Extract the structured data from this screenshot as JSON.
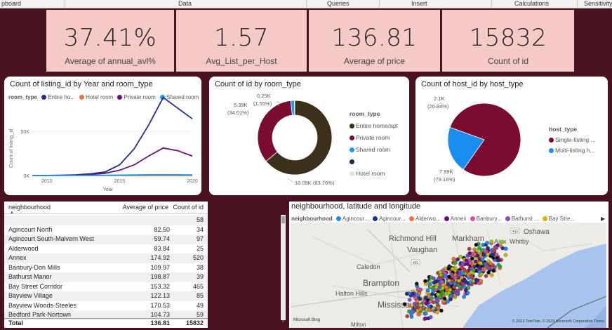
{
  "ribbon": {
    "tabs": [
      "pboard",
      "Data",
      "Queries",
      "Insert",
      "Calculations",
      "Sensitivity"
    ]
  },
  "kpis": [
    {
      "value": "37.41%",
      "label": "Average of annual_avl%"
    },
    {
      "value": "1.57",
      "label": "Avg_List_per_Host"
    },
    {
      "value": "136.81",
      "label": "Average of price"
    },
    {
      "value": "15832",
      "label": "Count of id"
    }
  ],
  "line_card": {
    "title": "Count of listing_id by Year and room_type",
    "legend_title": "room_type",
    "legend": [
      "Entire ho...",
      "Hotel room",
      "Private room",
      "Shared room"
    ]
  },
  "donut_card": {
    "title": "Count of id by room_type",
    "legend_title": "room_type",
    "legend": [
      "Entire home/apt",
      "Private room",
      "Shared room",
      "",
      "Hotel room"
    ],
    "labels": {
      "shared": "0.25K",
      "shared_pct": "(1.55%)",
      "private": "5.39K",
      "private_pct": "(34.01%)",
      "entire": "10.09K (63.76%)"
    }
  },
  "pie_card": {
    "title": "Count of host_id by host_type",
    "legend_title": "host_type",
    "legend": [
      "Single-listing ...",
      "Multi-listing h..."
    ],
    "labels": {
      "multi": "2.1K",
      "multi_pct": "(20.84%)",
      "single": "7.99K",
      "single_pct": "(79.16%)"
    }
  },
  "table": {
    "headers": [
      "neighbourhood",
      "Average of price",
      "Count of id"
    ],
    "rows": [
      [
        "",
        "",
        "58"
      ],
      [
        "Agincourt North",
        "82.50",
        "34"
      ],
      [
        "Agincourt South-Malvern West",
        "59.74",
        "97"
      ],
      [
        "Alderwood",
        "83.84",
        "25"
      ],
      [
        "Annex",
        "174.92",
        "520"
      ],
      [
        "Banbury-Don Mills",
        "109.97",
        "38"
      ],
      [
        "Bathurst Manor",
        "198.87",
        "39"
      ],
      [
        "Bay Street Corridor",
        "153.32",
        "465"
      ],
      [
        "Bayview Village",
        "122.13",
        "85"
      ],
      [
        "Bayview Woods-Steeles",
        "170.53",
        "49"
      ],
      [
        "Bedford Park-Nortown",
        "104.73",
        "59"
      ]
    ],
    "total": [
      "Total",
      "136.81",
      "15832"
    ]
  },
  "map_card": {
    "title": "neighbourhood, latitude and longitude",
    "legend_title": "neighbourhood",
    "legend": [
      "Agincour...",
      "Agincour...",
      "Alderwo...",
      "Annex",
      "Banbury...",
      "Bathurst ...",
      "Bay Stre..."
    ],
    "places": [
      "Richmond Hill",
      "Markham",
      "Oshawa",
      "Vaughan",
      "Ajax",
      "Whitby",
      "Caledon",
      "Brampton",
      "Halton Hills",
      "Mississauga",
      "Milton"
    ],
    "road_labels": [
      "412",
      "401"
    ],
    "attribution": "© 2023 TomTom, © 2023 Microsoft Corporation  Terms",
    "bing": "Microsoft Bing"
  },
  "chart_data": [
    {
      "type": "line",
      "title": "Count of listing_id by Year and room_type",
      "xlabel": "Year",
      "ylabel": "Count of listing_id",
      "x": [
        2009,
        2010,
        2011,
        2012,
        2013,
        2014,
        2015,
        2016,
        2017,
        2018,
        2019,
        2020
      ],
      "xlim": [
        2009,
        2020
      ],
      "ylim": [
        0,
        80000
      ],
      "xticks": [
        "2010",
        "2015",
        "2020"
      ],
      "yticks": [
        "0K",
        "50K"
      ],
      "series": [
        {
          "name": "Entire ho...",
          "color": "#1f2f8f",
          "values": [
            0,
            100,
            300,
            800,
            2000,
            4000,
            12000,
            30000,
            57000,
            88000,
            76000,
            64000
          ]
        },
        {
          "name": "Hotel room",
          "color": "#e8743b",
          "values": [
            0,
            0,
            0,
            0,
            0,
            0,
            0,
            0,
            0,
            0,
            0,
            0
          ]
        },
        {
          "name": "Private room",
          "color": "#6a0f7a",
          "values": [
            0,
            50,
            200,
            500,
            1200,
            2500,
            6000,
            12000,
            22000,
            31000,
            28000,
            22000
          ]
        },
        {
          "name": "Shared room",
          "color": "#1a9df0",
          "values": [
            0,
            0,
            50,
            100,
            200,
            300,
            500,
            700,
            900,
            1000,
            900,
            700
          ]
        }
      ]
    },
    {
      "type": "pie",
      "title": "Count of id by room_type",
      "categories": [
        "Entire home/apt",
        "Private room",
        "Shared room",
        "Hotel room"
      ],
      "values": [
        10090,
        5390,
        250,
        30
      ],
      "colors": [
        "#3e311c",
        "#7a0c30",
        "#1a9df0",
        "#1e2a44"
      ]
    },
    {
      "type": "pie",
      "title": "Count of host_id by host_type",
      "categories": [
        "Single-listing ...",
        "Multi-listing h..."
      ],
      "values": [
        7990,
        2100
      ],
      "colors": [
        "#7a0c30",
        "#1a8df0"
      ]
    }
  ]
}
